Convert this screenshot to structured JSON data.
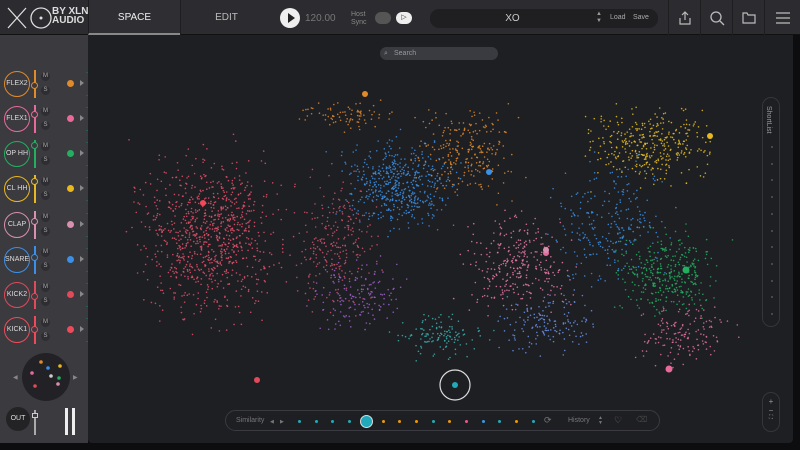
{
  "header": {
    "logo_text_top": "BY XLN",
    "logo_text_bottom": "AUDIO",
    "tabs": [
      {
        "label": "SPACE",
        "active": true
      },
      {
        "label": "EDIT",
        "active": false
      }
    ],
    "tempo": "120.00",
    "host_sync_label": "Host Sync",
    "preset_name": "XO",
    "load_label": "Load",
    "save_label": "Save"
  },
  "tracks": [
    {
      "name": "FLEX2",
      "color": "#e08a2a"
    },
    {
      "name": "FLEX1",
      "color": "#e86a9a"
    },
    {
      "name": "OP HH",
      "color": "#22b060"
    },
    {
      "name": "CL HH",
      "color": "#e8b820"
    },
    {
      "name": "CLAP",
      "color": "#d890b0"
    },
    {
      "name": "SNARE",
      "color": "#3a90e8"
    },
    {
      "name": "KICK2",
      "color": "#e04a5a"
    },
    {
      "name": "KICK1",
      "color": "#f04a5a"
    }
  ],
  "mute_label": "M",
  "solo_label": "S",
  "output_label": "OUT",
  "search_placeholder": "Search",
  "similarity": {
    "label": "Similarity",
    "history_label": "History",
    "dots": [
      "#2ab",
      "#2ab",
      "#2ab",
      "#2ab",
      "sel",
      "#e90",
      "#e90",
      "#e90",
      "#2ab",
      "#e90",
      "#e58",
      "#39e",
      "#2ab",
      "#e90",
      "#2ab"
    ]
  },
  "shortlist_label": "ShortList"
}
